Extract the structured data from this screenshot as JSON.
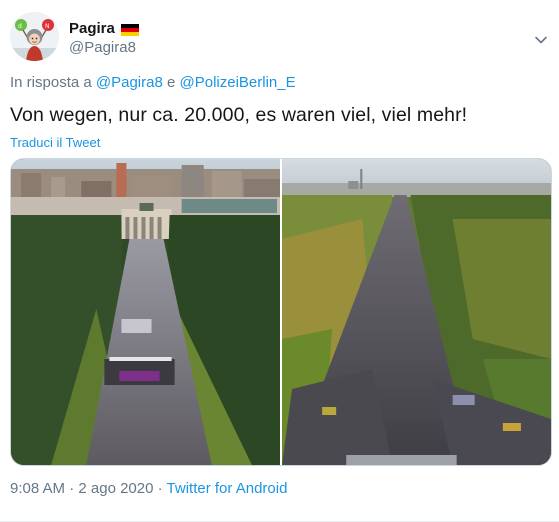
{
  "author": {
    "display_name": "Pagira",
    "username": "@Pagira8",
    "flag_icon": "germany-flag-icon",
    "flag_colors": [
      "#000000",
      "#dd0000",
      "#ffce00"
    ]
  },
  "reply": {
    "prefix": "In risposta a",
    "mention1": "@Pagira8",
    "conjunction": "e",
    "mention2": "@PolizeiBerlin_E"
  },
  "tweet": {
    "text": "Von wegen, nur ca. 20.000, es waren viel, viel mehr!",
    "translate_label": "Traduci il Tweet"
  },
  "media": {
    "photos": [
      "crowd-brandenburg-gate-photo",
      "crowd-avenue-victory-column-photo"
    ]
  },
  "meta": {
    "time": "9:08 AM",
    "separator": "·",
    "date": "2 ago 2020",
    "source": "Twitter for Android"
  },
  "colors": {
    "link": "#1b95e0",
    "secondary_text": "#657786",
    "primary_text": "#14171a"
  }
}
